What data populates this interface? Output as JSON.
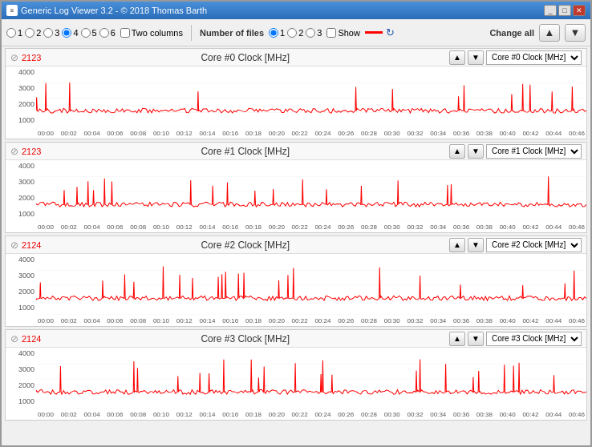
{
  "window": {
    "title": "Generic Log Viewer 3.2 - © 2018 Thomas Barth"
  },
  "toolbar": {
    "radio_group1": {
      "label": "Radio group 1",
      "options": [
        "1",
        "2",
        "3",
        "4",
        "5",
        "6"
      ],
      "selected": "4"
    },
    "two_columns_label": "Two columns",
    "number_of_files_label": "Number of files",
    "file_radio_options": [
      "1",
      "2",
      "3"
    ],
    "file_selected": "1",
    "show_label": "Show",
    "change_all_label": "Change all",
    "up_arrow": "▲",
    "down_arrow": "▼"
  },
  "charts": [
    {
      "id": "chart0",
      "symbol": "⊘",
      "value": "2123",
      "title": "Core #0 Clock [MHz]",
      "select_option": "Core #0 Clock [MHz]",
      "yaxis": [
        "4000",
        "3000",
        "2000",
        "1000"
      ],
      "xaxis": [
        "00:00",
        "00:02",
        "00:04",
        "00:06",
        "00:08",
        "00:10",
        "00:12",
        "00:14",
        "00:16",
        "00:18",
        "00:20",
        "00:22",
        "00:24",
        "00:26",
        "00:28",
        "00:30",
        "00:32",
        "00:34",
        "00:36",
        "00:38",
        "00:40",
        "00:42",
        "00:44",
        "00:46"
      ]
    },
    {
      "id": "chart1",
      "symbol": "⊘",
      "value": "2123",
      "title": "Core #1 Clock [MHz]",
      "select_option": "Core #1 Clock [MHz]",
      "yaxis": [
        "4000",
        "3000",
        "2000",
        "1000"
      ],
      "xaxis": [
        "00:00",
        "00:02",
        "00:04",
        "00:06",
        "00:08",
        "00:10",
        "00:12",
        "00:14",
        "00:16",
        "00:18",
        "00:20",
        "00:22",
        "00:24",
        "00:26",
        "00:28",
        "00:30",
        "00:32",
        "00:34",
        "00:36",
        "00:38",
        "00:40",
        "00:42",
        "00:44",
        "00:46"
      ]
    },
    {
      "id": "chart2",
      "symbol": "⊘",
      "value": "2124",
      "title": "Core #2 Clock [MHz]",
      "select_option": "Core #2 Clock [MHz]",
      "yaxis": [
        "4000",
        "3000",
        "2000",
        "1000"
      ],
      "xaxis": [
        "00:00",
        "00:02",
        "00:04",
        "00:06",
        "00:08",
        "00:10",
        "00:12",
        "00:14",
        "00:16",
        "00:18",
        "00:20",
        "00:22",
        "00:24",
        "00:26",
        "00:28",
        "00:30",
        "00:32",
        "00:34",
        "00:36",
        "00:38",
        "00:40",
        "00:42",
        "00:44",
        "00:46"
      ]
    },
    {
      "id": "chart3",
      "symbol": "⊘",
      "value": "2124",
      "title": "Core #3 Clock [MHz]",
      "select_option": "Core #3 Clock [MHz]",
      "yaxis": [
        "4000",
        "3000",
        "2000",
        "1000"
      ],
      "xaxis": [
        "00:00",
        "00:02",
        "00:04",
        "00:06",
        "00:08",
        "00:10",
        "00:12",
        "00:14",
        "00:16",
        "00:18",
        "00:20",
        "00:22",
        "00:24",
        "00:26",
        "00:28",
        "00:30",
        "00:32",
        "00:34",
        "00:36",
        "00:38",
        "00:40",
        "00:42",
        "00:44",
        "00:46"
      ]
    }
  ]
}
